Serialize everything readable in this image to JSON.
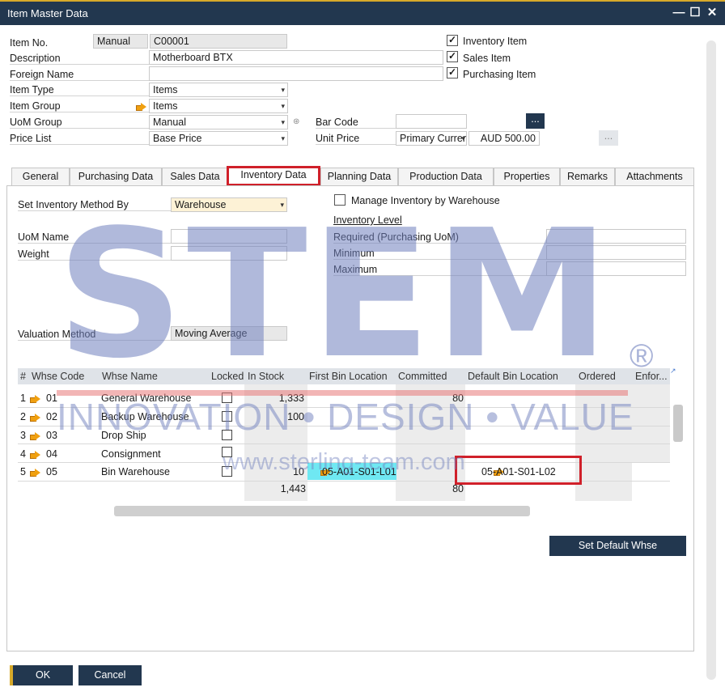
{
  "window": {
    "title": "Item Master Data"
  },
  "header": {
    "item_no_label": "Item No.",
    "series": "Manual",
    "item_no": "C00001",
    "description_label": "Description",
    "description": "Motherboard BTX",
    "foreign_name_label": "Foreign Name",
    "foreign_name": "",
    "item_type_label": "Item Type",
    "item_type": "Items",
    "item_group_label": "Item Group",
    "item_group": "Items",
    "uom_group_label": "UoM Group",
    "uom_group": "Manual",
    "price_list_label": "Price List",
    "price_list": "Base Price",
    "barcode_label": "Bar Code",
    "barcode": "",
    "barcode_btn": "...",
    "unit_price_label": "Unit Price",
    "currency": "Primary Curren",
    "unit_price": "AUD 500.00",
    "price_btn": "...",
    "inventory_item": "Inventory Item",
    "sales_item": "Sales Item",
    "purchasing_item": "Purchasing Item"
  },
  "tabs": [
    "General",
    "Purchasing Data",
    "Sales Data",
    "Inventory Data",
    "Planning Data",
    "Production Data",
    "Properties",
    "Remarks",
    "Attachments"
  ],
  "inventory": {
    "method_label": "Set Inventory Method By",
    "method": "Warehouse",
    "manage_by_wh": "Manage Inventory by Warehouse",
    "inv_level": "Inventory Level",
    "uom_name_label": "UoM Name",
    "uom_name": "",
    "weight_label": "Weight",
    "weight": "",
    "required_label": "Required (Purchasing UoM)",
    "required": "",
    "minimum_label": "Minimum",
    "minimum": "",
    "maximum_label": "Maximum",
    "maximum": "",
    "valuation_label": "Valuation Method",
    "valuation": "Moving Average"
  },
  "grid": {
    "columns": [
      "#",
      "Whse Code",
      "Whse Name",
      "Locked",
      "In Stock",
      "First Bin Location",
      "Committed",
      "Default Bin Location",
      "Ordered",
      "Enfor..."
    ],
    "rows": [
      {
        "num": "1",
        "code": "01",
        "name": "General Warehouse",
        "in_stock": "1,333",
        "first_bin": "",
        "committed": "80",
        "default_bin": "",
        "ordered": ""
      },
      {
        "num": "2",
        "code": "02",
        "name": "Backup Warehouse",
        "in_stock": "100",
        "first_bin": "",
        "committed": "",
        "default_bin": "",
        "ordered": ""
      },
      {
        "num": "3",
        "code": "03",
        "name": "Drop Ship",
        "in_stock": "",
        "first_bin": "",
        "committed": "",
        "default_bin": "",
        "ordered": ""
      },
      {
        "num": "4",
        "code": "04",
        "name": "Consignment",
        "in_stock": "",
        "first_bin": "",
        "committed": "",
        "default_bin": "",
        "ordered": ""
      },
      {
        "num": "5",
        "code": "05",
        "name": "Bin Warehouse",
        "in_stock": "10",
        "first_bin": "05-A01-S01-L01",
        "committed": "",
        "default_bin": "05-A01-S01-L02",
        "ordered": ""
      }
    ],
    "totals": {
      "in_stock": "1,443",
      "committed": "80"
    }
  },
  "buttons": {
    "set_default": "Set Default Whse",
    "ok": "OK",
    "cancel": "Cancel"
  },
  "watermark": {
    "big": "STEM",
    "registered": "®",
    "tagline": "INNOVATION • DESIGN • VALUE",
    "url": "www.sterling-team.com"
  },
  "colors": {
    "titlebar": "#22374f",
    "accent_gold": "#d7a92a",
    "highlight_red": "#d0202a",
    "bin_cyan": "#6fe8f2",
    "watermark": "#9aa7d0"
  }
}
